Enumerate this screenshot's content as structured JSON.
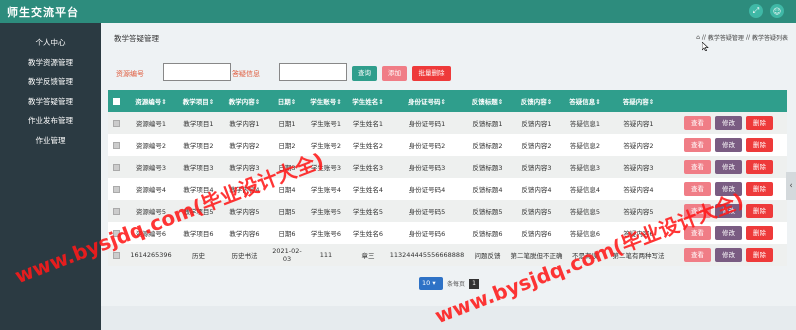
{
  "app": {
    "title": "师生交流平台"
  },
  "sidebar": {
    "items": [
      {
        "label": "个人中心"
      },
      {
        "label": "教学资源管理"
      },
      {
        "label": "教学反馈管理"
      },
      {
        "label": "教学答疑管理"
      },
      {
        "label": "作业发布管理"
      },
      {
        "label": "作业管理"
      }
    ]
  },
  "page": {
    "title": "教学答疑管理"
  },
  "breadcrumb": {
    "items": [
      "教学答疑管理",
      "教学答疑列表"
    ],
    "sep": "//"
  },
  "search": {
    "label1": "资源编号",
    "label2": "答疑信息",
    "value1": "",
    "value2": "",
    "query_label": "查询",
    "add_label": "添加",
    "batch_delete_label": "批量删除"
  },
  "table": {
    "columns": [
      "资源编号",
      "教学项目",
      "教学内容",
      "日期",
      "学生账号",
      "学生姓名",
      "身份证号码",
      "反馈标题",
      "反馈内容",
      "答疑信息",
      "答疑内容"
    ],
    "sort_glyph": "⇕",
    "rows": [
      [
        "资源编号1",
        "教学项目1",
        "教学内容1",
        "日期1",
        "学生账号1",
        "学生姓名1",
        "身份证号码1",
        "反馈标题1",
        "反馈内容1",
        "答疑信息1",
        "答疑内容1"
      ],
      [
        "资源编号2",
        "教学项目2",
        "教学内容2",
        "日期2",
        "学生账号2",
        "学生姓名2",
        "身份证号码2",
        "反馈标题2",
        "反馈内容2",
        "答疑信息2",
        "答疑内容2"
      ],
      [
        "资源编号3",
        "教学项目3",
        "教学内容3",
        "日期3",
        "学生账号3",
        "学生姓名3",
        "身份证号码3",
        "反馈标题3",
        "反馈内容3",
        "答疑信息3",
        "答疑内容3"
      ],
      [
        "资源编号4",
        "教学项目4",
        "教学内容4",
        "日期4",
        "学生账号4",
        "学生姓名4",
        "身份证号码4",
        "反馈标题4",
        "反馈内容4",
        "答疑信息4",
        "答疑内容4"
      ],
      [
        "资源编号5",
        "教学项目5",
        "教学内容5",
        "日期5",
        "学生账号5",
        "学生姓名5",
        "身份证号码5",
        "反馈标题5",
        "反馈内容5",
        "答疑信息5",
        "答疑内容5"
      ],
      [
        "资源编号6",
        "教学项目6",
        "教学内容6",
        "日期6",
        "学生账号6",
        "学生姓名6",
        "身份证号码6",
        "反馈标题6",
        "反馈内容6",
        "答疑信息6",
        "答疑内容6"
      ],
      [
        "1614265396",
        "历史",
        "历史书法",
        "2021-02-03",
        "111",
        "章三",
        "113244445556668888",
        "问题反馈",
        "第二笔脱但不正确",
        "不是有误",
        "第二笔有两种写法"
      ]
    ],
    "actions": {
      "view": "查看",
      "edit": "修改",
      "delete": "删除"
    }
  },
  "pagination": {
    "page_size": "10",
    "label": "条每页",
    "current_page": "1"
  },
  "watermark": {
    "text_a": "www.bysjdq.com(毕业设计大全)",
    "text_b": "www.bysjdq.com(毕业设计大全)"
  },
  "colors": {
    "header": "#2d8c7d",
    "sidebar": "#2b3a42",
    "table_header": "#2f9e8c",
    "view": "#f07d86",
    "edit": "#7a5c82",
    "delete": "#ee3a3a",
    "query": "#2f9e8c",
    "add": "#f07d86",
    "batch_delete": "#ee3a3a"
  }
}
